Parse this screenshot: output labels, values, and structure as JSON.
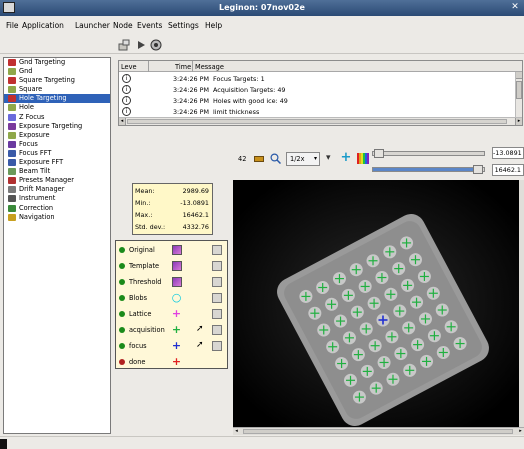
{
  "window": {
    "title": "Leginon: 07nov02e"
  },
  "menu": [
    "File",
    "Application",
    "Launcher",
    "Node",
    "Events",
    "Settings",
    "Help"
  ],
  "toolbar": {
    "icons": [
      "launch-icon",
      "play-icon",
      "inspect-icon"
    ]
  },
  "nodes": [
    {
      "label": "Gnd Targeting",
      "color": "#c03030"
    },
    {
      "label": "Gnd",
      "color": "#8fa84a"
    },
    {
      "label": "Square Targeting",
      "color": "#c03030"
    },
    {
      "label": "Square",
      "color": "#8fa84a"
    },
    {
      "label": "Hole Targeting",
      "color": "#c03030",
      "selected": true
    },
    {
      "label": "Hole",
      "color": "#8fa84a"
    },
    {
      "label": "Z Focus",
      "color": "#6a6adc"
    },
    {
      "label": "Exposure Targeting",
      "color": "#7a3a9c"
    },
    {
      "label": "Exposure",
      "color": "#8fa84a"
    },
    {
      "label": "Focus",
      "color": "#6a3aa0"
    },
    {
      "label": "Focus FFT",
      "color": "#3a5aa8"
    },
    {
      "label": "Exposure FFT",
      "color": "#3a5aa8"
    },
    {
      "label": "Beam Tilt",
      "color": "#6a9a5a"
    },
    {
      "label": "Presets Manager",
      "color": "#b03030"
    },
    {
      "label": "Drift Manager",
      "color": "#7a7a7a"
    },
    {
      "label": "Instrument",
      "color": "#555555"
    },
    {
      "label": "Correction",
      "color": "#3a8a3a"
    },
    {
      "label": "Navigation",
      "color": "#c8a020"
    }
  ],
  "messages": {
    "columns": [
      "Leve",
      "Time",
      "Message"
    ],
    "rows": [
      {
        "time": "3:24:26 PM",
        "message": "Focus Targets: 1"
      },
      {
        "time": "3:24:26 PM",
        "message": "Acquisition Targets: 49"
      },
      {
        "time": "3:24:26 PM",
        "message": "Holes with good ice: 49"
      },
      {
        "time": "3:24:26 PM",
        "message": "limit thickness"
      }
    ]
  },
  "image_controls": {
    "count": "42",
    "zoom": "1/2x",
    "min_value": "-13.0891",
    "max_value": "16462.1",
    "min_slider": 0.05,
    "max_slider": 0.98
  },
  "stats": {
    "mean_label": "Mean:",
    "mean": "2989.69",
    "min_label": "Min.:",
    "min": "-13.0891",
    "max_label": "Max.:",
    "max": "16462.1",
    "std_label": "Std. dev.:",
    "std": "4332.76"
  },
  "layers": [
    {
      "name": "Original",
      "dot": "#1a8a1a",
      "kind": "image"
    },
    {
      "name": "Template",
      "dot": "#1a8a1a",
      "kind": "image"
    },
    {
      "name": "Threshold",
      "dot": "#1a8a1a",
      "kind": "image"
    },
    {
      "name": "Blobs",
      "dot": "#1a8a1a",
      "kind": "circle",
      "color": "#00c8e0"
    },
    {
      "name": "Lattice",
      "dot": "#1a8a1a",
      "kind": "plus",
      "color": "#e040e0"
    },
    {
      "name": "acquisition",
      "dot": "#1a8a1a",
      "kind": "plus",
      "color": "#20b040",
      "cursor": true
    },
    {
      "name": "focus",
      "dot": "#1a8a1a",
      "kind": "plus",
      "color": "#2030d0",
      "cursor": true
    },
    {
      "name": "done",
      "dot": "#b02020",
      "kind": "plus",
      "color": "#e02020"
    }
  ],
  "colors": {
    "selection": "#2f62b8",
    "acquisition": "#20b040",
    "focus": "#2030d0"
  }
}
